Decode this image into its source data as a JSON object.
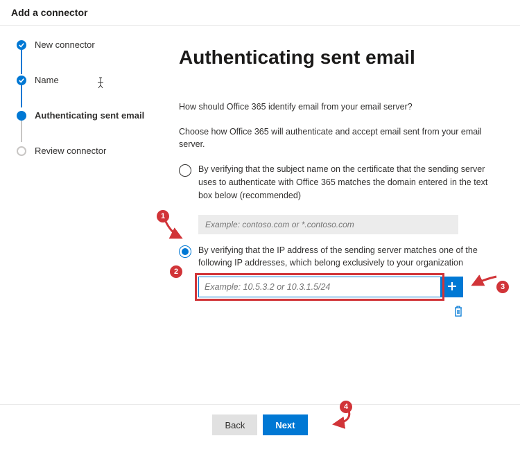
{
  "header_title": "Add a connector",
  "steps": {
    "s0": "New connector",
    "s1": "Name",
    "s2": "Authenticating sent email",
    "s3": "Review connector"
  },
  "page": {
    "title": "Authenticating sent email",
    "question": "How should Office 365 identify email from your email server?",
    "instruction": "Choose how Office 365 will authenticate and accept email sent from your email server.",
    "opt_cert": "By verifying that the subject name on the certificate that the sending server uses to authenticate with Office 365 matches the domain entered in the text box below (recommended)",
    "domain_placeholder": "Example: contoso.com or *.contoso.com",
    "opt_ip": "By verifying that the IP address of the sending server matches one of the following IP addresses, which belong exclusively to your organization",
    "ip_placeholder": "Example: 10.5.3.2 or 10.3.1.5/24"
  },
  "callouts": {
    "c1": "1",
    "c2": "2",
    "c3": "3",
    "c4": "4"
  },
  "footer": {
    "back": "Back",
    "next": "Next"
  }
}
